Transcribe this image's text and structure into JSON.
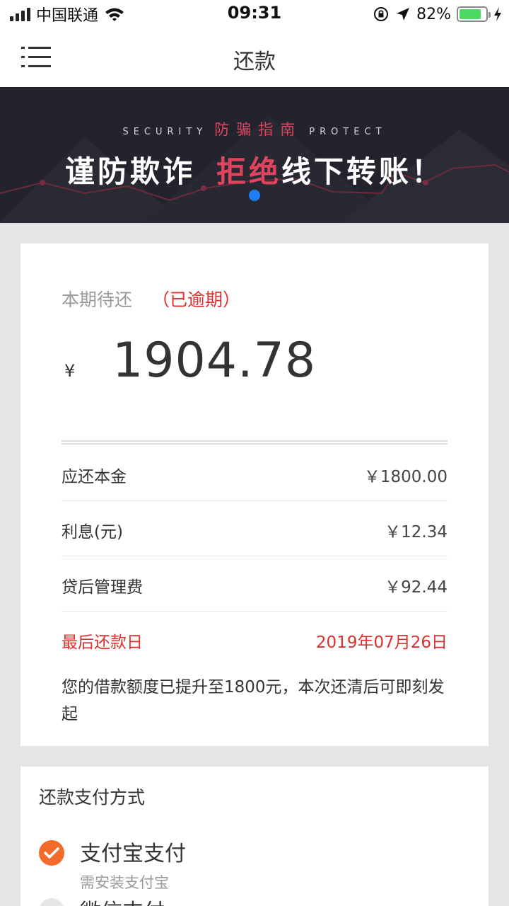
{
  "status_bar": {
    "carrier": "中国联通",
    "time": "09:31",
    "battery": "82%",
    "battery_level": 0.82
  },
  "nav": {
    "title": "还款",
    "menu_icon": "menu-icon"
  },
  "banner": {
    "sub_left": "SECURITY",
    "sub_cn": "防骗指南",
    "sub_right": "PROTECT",
    "main_text": "谨防欺诈",
    "main_highlight": "拒绝",
    "main_tail": "线下转账！",
    "accent_color": "#e0435d",
    "indicator_color": "#1e7cf5"
  },
  "bill": {
    "label": "本期待还",
    "status": "（已逾期）",
    "currency": "¥",
    "amount": "1904.78",
    "rows": [
      {
        "label": "应还本金",
        "value": "￥1800.00"
      },
      {
        "label": "利息(元)",
        "value": "￥12.34"
      },
      {
        "label": "贷后管理费",
        "value": "￥92.44"
      }
    ],
    "due_label": "最后还款日",
    "due_date": "2019年07月26日",
    "note": "您的借款额度已提升至1800元，本次还清后可即刻发起"
  },
  "payment": {
    "title": "还款支付方式",
    "options": [
      {
        "name": "支付宝支付",
        "desc": "需安装支付宝",
        "selected": true
      },
      {
        "name": "微信支付",
        "desc": "",
        "selected": false
      }
    ],
    "selected_color": "#f26b2a"
  }
}
